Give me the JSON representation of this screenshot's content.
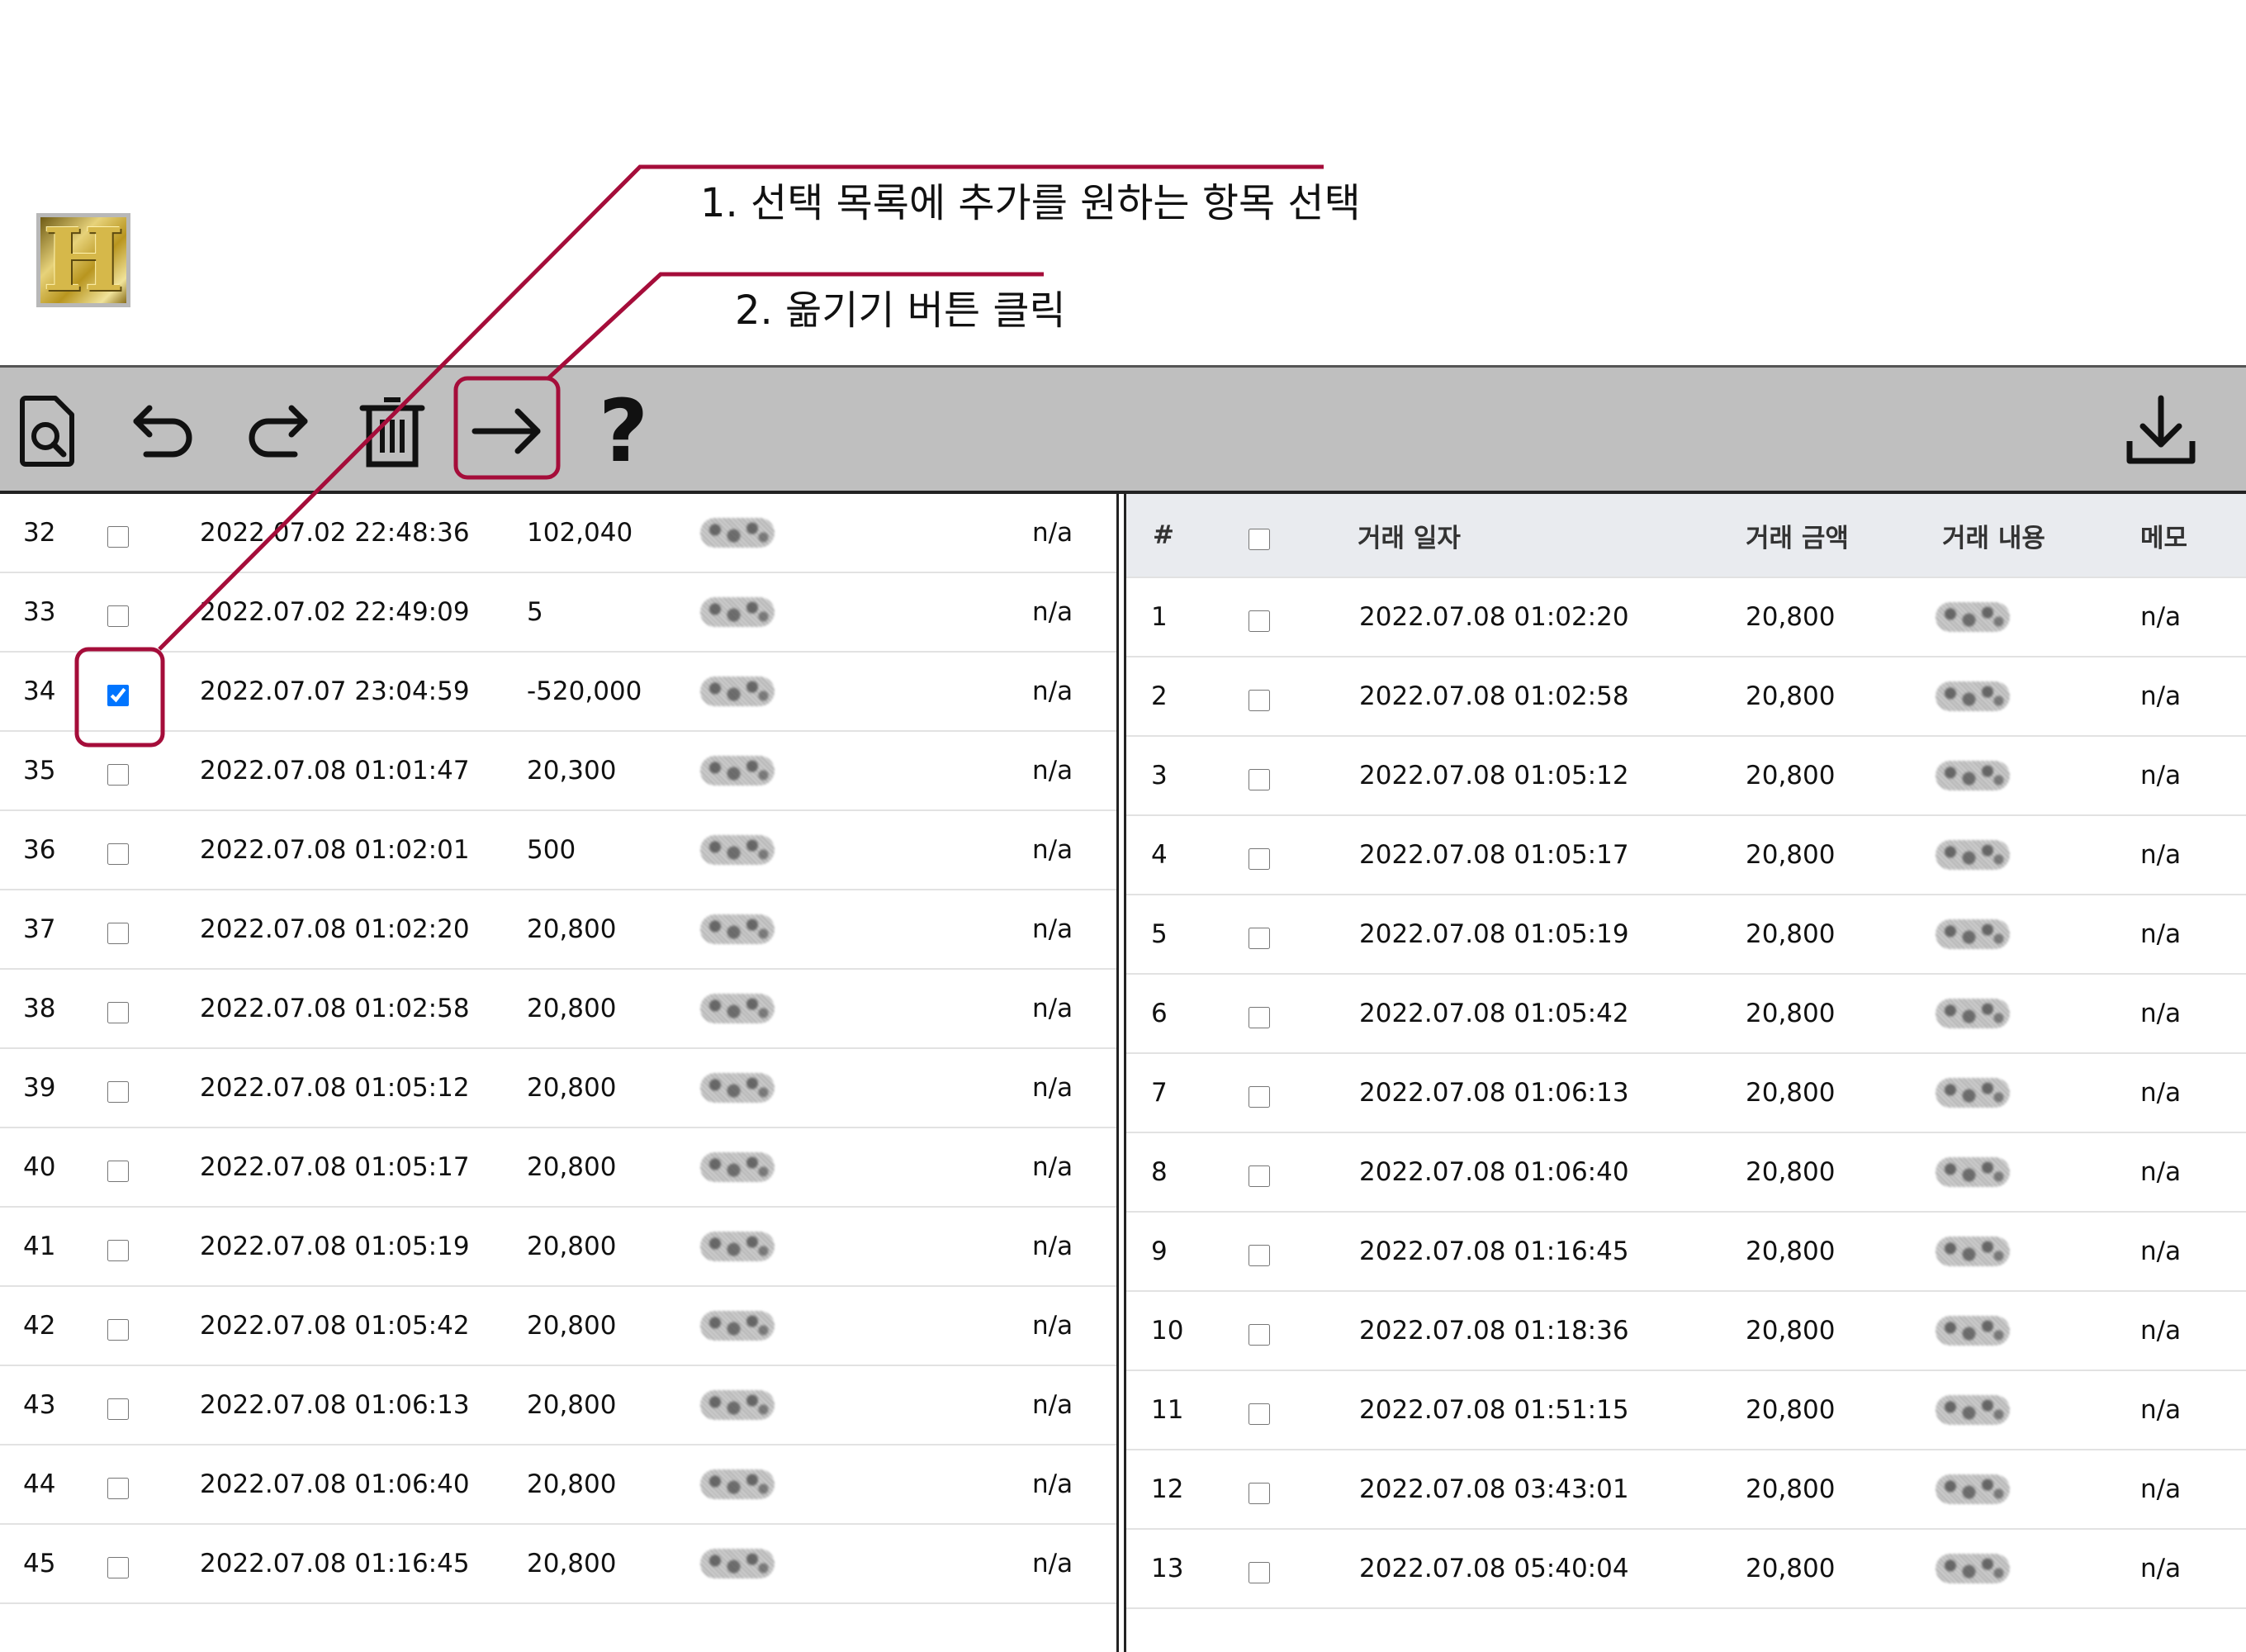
{
  "annotations": {
    "step1": "1. 선택 목록에 추가를 원하는 항목 선택",
    "step2": "2. 옮기기 버튼 클릭"
  },
  "logo": {
    "letter": "H"
  },
  "toolbar": {
    "help_label": "?",
    "icons": [
      "document-search-icon",
      "undo-icon",
      "redo-icon",
      "trash-icon",
      "move-right-arrow-icon",
      "help-icon",
      "download-icon"
    ]
  },
  "left_table": {
    "rows": [
      {
        "num": "32",
        "checked": false,
        "date": "2022.07.02 22:48:36",
        "amount": "102,040",
        "memo": "n/a"
      },
      {
        "num": "33",
        "checked": false,
        "date": "2022.07.02 22:49:09",
        "amount": "5",
        "memo": "n/a"
      },
      {
        "num": "34",
        "checked": true,
        "date": "2022.07.07 23:04:59",
        "amount": "-520,000",
        "memo": "n/a"
      },
      {
        "num": "35",
        "checked": false,
        "date": "2022.07.08 01:01:47",
        "amount": "20,300",
        "memo": "n/a"
      },
      {
        "num": "36",
        "checked": false,
        "date": "2022.07.08 01:02:01",
        "amount": "500",
        "memo": "n/a"
      },
      {
        "num": "37",
        "checked": false,
        "date": "2022.07.08 01:02:20",
        "amount": "20,800",
        "memo": "n/a"
      },
      {
        "num": "38",
        "checked": false,
        "date": "2022.07.08 01:02:58",
        "amount": "20,800",
        "memo": "n/a"
      },
      {
        "num": "39",
        "checked": false,
        "date": "2022.07.08 01:05:12",
        "amount": "20,800",
        "memo": "n/a"
      },
      {
        "num": "40",
        "checked": false,
        "date": "2022.07.08 01:05:17",
        "amount": "20,800",
        "memo": "n/a"
      },
      {
        "num": "41",
        "checked": false,
        "date": "2022.07.08 01:05:19",
        "amount": "20,800",
        "memo": "n/a"
      },
      {
        "num": "42",
        "checked": false,
        "date": "2022.07.08 01:05:42",
        "amount": "20,800",
        "memo": "n/a"
      },
      {
        "num": "43",
        "checked": false,
        "date": "2022.07.08 01:06:13",
        "amount": "20,800",
        "memo": "n/a"
      },
      {
        "num": "44",
        "checked": false,
        "date": "2022.07.08 01:06:40",
        "amount": "20,800",
        "memo": "n/a"
      },
      {
        "num": "45",
        "checked": false,
        "date": "2022.07.08 01:16:45",
        "amount": "20,800",
        "memo": "n/a"
      }
    ]
  },
  "right_table": {
    "headers": {
      "num": "#",
      "date": "거래 일자",
      "amount": "거래 금액",
      "desc": "거래 내용",
      "memo": "메모"
    },
    "rows": [
      {
        "num": "1",
        "checked": false,
        "date": "2022.07.08 01:02:20",
        "amount": "20,800",
        "memo": "n/a"
      },
      {
        "num": "2",
        "checked": false,
        "date": "2022.07.08 01:02:58",
        "amount": "20,800",
        "memo": "n/a"
      },
      {
        "num": "3",
        "checked": false,
        "date": "2022.07.08 01:05:12",
        "amount": "20,800",
        "memo": "n/a"
      },
      {
        "num": "4",
        "checked": false,
        "date": "2022.07.08 01:05:17",
        "amount": "20,800",
        "memo": "n/a"
      },
      {
        "num": "5",
        "checked": false,
        "date": "2022.07.08 01:05:19",
        "amount": "20,800",
        "memo": "n/a"
      },
      {
        "num": "6",
        "checked": false,
        "date": "2022.07.08 01:05:42",
        "amount": "20,800",
        "memo": "n/a"
      },
      {
        "num": "7",
        "checked": false,
        "date": "2022.07.08 01:06:13",
        "amount": "20,800",
        "memo": "n/a"
      },
      {
        "num": "8",
        "checked": false,
        "date": "2022.07.08 01:06:40",
        "amount": "20,800",
        "memo": "n/a"
      },
      {
        "num": "9",
        "checked": false,
        "date": "2022.07.08 01:16:45",
        "amount": "20,800",
        "memo": "n/a"
      },
      {
        "num": "10",
        "checked": false,
        "date": "2022.07.08 01:18:36",
        "amount": "20,800",
        "memo": "n/a"
      },
      {
        "num": "11",
        "checked": false,
        "date": "2022.07.08 01:51:15",
        "amount": "20,800",
        "memo": "n/a"
      },
      {
        "num": "12",
        "checked": false,
        "date": "2022.07.08 03:43:01",
        "amount": "20,800",
        "memo": "n/a"
      },
      {
        "num": "13",
        "checked": false,
        "date": "2022.07.08 05:40:04",
        "amount": "20,800",
        "memo": "n/a"
      }
    ]
  },
  "colors": {
    "annotation": "#a50d3a",
    "toolbar_bg": "#bfbfbf",
    "header_bg": "#e9ebef",
    "checkbox_checked": "#1a73e8"
  }
}
